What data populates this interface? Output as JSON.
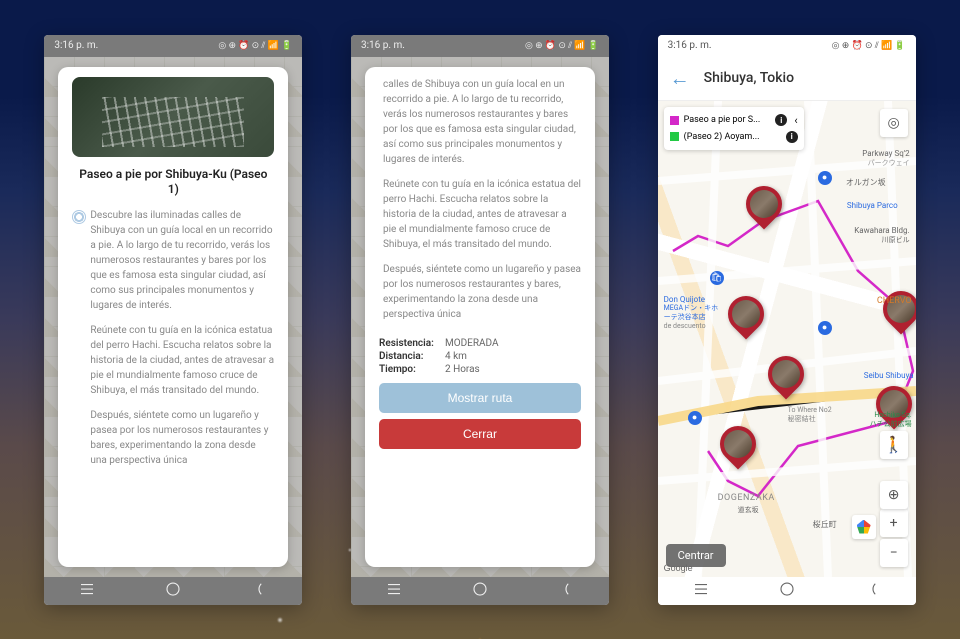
{
  "status": {
    "time": "3:16 p. m.",
    "icons": "◎ ⊕ ⏰ ⊙ ⫽ 📶 🔋"
  },
  "screen1": {
    "title": "Paseo a pie por Shibuya-Ku (Paseo 1)",
    "p1": "Descubre las iluminadas calles de Shibuya con un guía local en un recorrido a pie. A lo largo de tu recorrido, verás los numerosos restaurantes y bares por los que es famosa esta singular ciudad, así como sus principales monumentos y lugares de interés.",
    "p2": "Reúnete con tu guía en la icónica estatua del perro Hachi. Escucha relatos sobre la historia de la ciudad, antes de atravesar a pie el mundialmente famoso cruce de Shibuya, el más transitado del mundo.",
    "p3": "Después, siéntete como un lugareño y pasea por los numerosos restaurantes y bares, experimentando la zona desde una perspectiva única"
  },
  "screen2": {
    "p1": "calles de Shibuya con un guía local en un recorrido a pie. A lo largo de tu recorrido, verás los numerosos restaurantes y bares por los que es famosa esta singular ciudad, así como sus principales monumentos y lugares de interés.",
    "p2": "Reúnete con tu guía en la icónica estatua del perro Hachi. Escucha relatos sobre la historia de la ciudad, antes de atravesar a pie el mundialmente famoso cruce de Shibuya, el más transitado del mundo.",
    "p3": "Después, siéntete como un lugareño y pasea por los numerosos restaurantes y bares, experimentando la zona desde una perspectiva única",
    "stats": {
      "resistencia_k": "Resistencia:",
      "resistencia_v": "MODERADA",
      "distancia_k": "Distancia:",
      "distancia_v": "4 km",
      "tiempo_k": "Tiempo:",
      "tiempo_v": "2 Horas"
    },
    "btn_show": "Mostrar ruta",
    "btn_close": "Cerrar"
  },
  "screen3": {
    "title": "Shibuya, Tokio",
    "legend1": "Paseo a pie por S...",
    "legend2": "(Paseo 2) Aoyam...",
    "center_btn": "Centrar",
    "labels": {
      "parkway": "Parkway Sq'2",
      "parkway_jp": "パークウェイ",
      "organ": "オルガン坂",
      "parco": "Shibuya Parco",
      "kawahara": "Kawahara Bldg.",
      "kawahara_jp": "川原ビル",
      "donki": "Don Quijote",
      "donki2": "MEGAドン・キホ",
      "donki3": "ーテ渋谷本店",
      "donki4": "de descuento",
      "chervo": "CHERVO",
      "seibu": "Seibu Shibuya",
      "hachiko": "Hachiko Sq.",
      "hachiko_jp": "ハチ公前広場",
      "towhere": "To Where No2",
      "towhere_jp": "秘密結社",
      "dogenzaka": "DOGENZAKA",
      "dogenzaka_jp": "道玄坂",
      "sakuragaoka": "桜丘町",
      "google": "Google"
    }
  }
}
